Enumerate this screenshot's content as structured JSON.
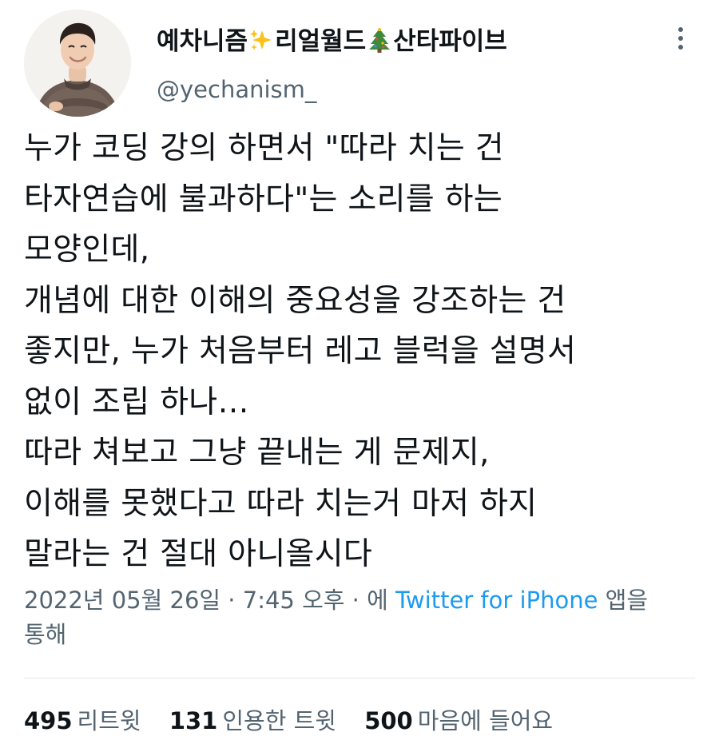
{
  "author": {
    "name_part1": "예차니즘",
    "name_emoji1": "sparkles-icon",
    "name_part2": "리얼월드",
    "name_emoji2": "christmas-tree-icon",
    "name_part3": "산타파이브",
    "handle": "@yechanism_"
  },
  "tweet": {
    "lines": [
      "누가 코딩 강의 하면서 \"따라 치는 건",
      "타자연습에 불과하다\"는 소리를 하는",
      "모양인데,",
      "개념에 대한 이해의 중요성을 강조하는 건",
      "좋지만, 누가 처음부터 레고 블럭을 설명서",
      "없이 조립 하나…",
      "따라 쳐보고 그냥 끝내는 게 문제지,",
      "이해를 못했다고 따라 치는거 마저 하지",
      "말라는 건 절대 아니올시다"
    ]
  },
  "meta": {
    "date": "2022년 05월 26일",
    "sep1": " · ",
    "time": "7:45 오후",
    "sep2": " · 에 ",
    "source": "Twitter for iPhone",
    "suffix1": " 앱을",
    "suffix2": "통해"
  },
  "stats": {
    "retweets_count": "495",
    "retweets_label": "리트윗",
    "quotes_count": "131",
    "quotes_label": "인용한 트윗",
    "likes_count": "500",
    "likes_label": "마음에 들어요"
  },
  "colors": {
    "text": "#0f1419",
    "secondary": "#536471",
    "link": "#1d9bf0",
    "divider": "#e3e6e9"
  }
}
